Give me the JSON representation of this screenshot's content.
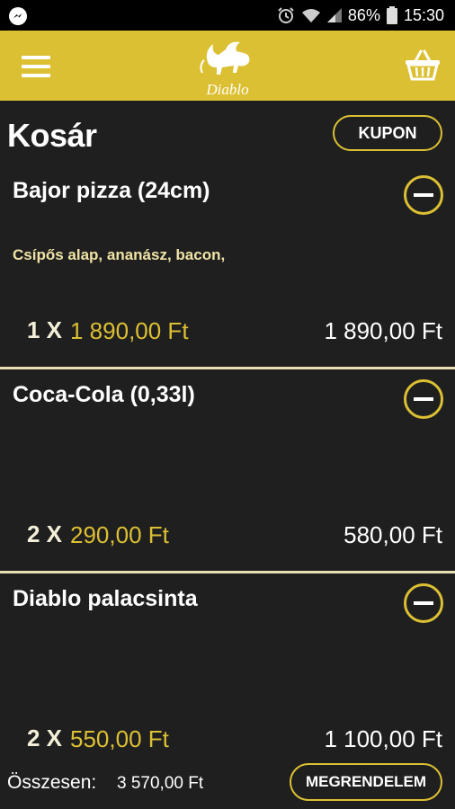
{
  "status_bar": {
    "battery": "86%",
    "time": "15:30",
    "icons": [
      "messenger-icon",
      "alarm-icon",
      "wifi-icon",
      "signal-icon",
      "battery-icon"
    ]
  },
  "app_bar": {
    "logo_text": "Diablo",
    "menu_icon": "hamburger-menu-icon",
    "cart_icon": "basket-icon",
    "color": "#dcc033"
  },
  "page": {
    "title": "Kosár",
    "coupon_label": "KUPON"
  },
  "cart": {
    "items": [
      {
        "name": "Bajor pizza (24cm)",
        "toppings": "Csípős alap, ananász, bacon,",
        "quantity": "1 X",
        "unit_price": "1 890,00 Ft",
        "total": "1 890,00 Ft"
      },
      {
        "name": "Coca-Cola (0,33l)",
        "toppings": "",
        "quantity": "2 X",
        "unit_price": "290,00 Ft",
        "total": "580,00 Ft"
      },
      {
        "name": "Diablo palacsinta",
        "toppings": "",
        "quantity": "2 X",
        "unit_price": "550,00 Ft",
        "total": "1 100,00 Ft"
      }
    ]
  },
  "footer": {
    "total_label": "Összesen:",
    "total_value": "3 570,00 Ft",
    "order_label": "MEGRENDELEM"
  },
  "colors": {
    "accent": "#dcc033",
    "background": "#1f1f1f",
    "divider": "#e9dfb5"
  }
}
